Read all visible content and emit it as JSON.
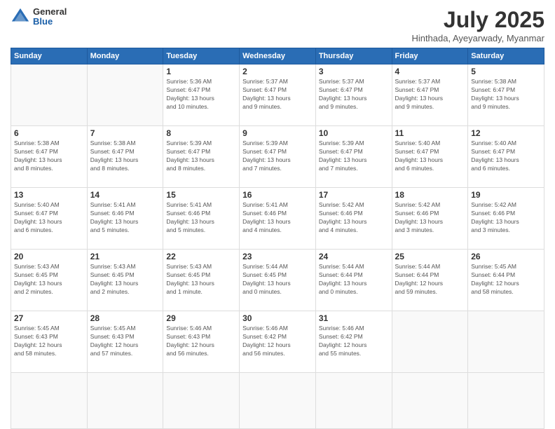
{
  "logo": {
    "general": "General",
    "blue": "Blue"
  },
  "title": "July 2025",
  "location": "Hinthada, Ayeyarwady, Myanmar",
  "weekdays": [
    "Sunday",
    "Monday",
    "Tuesday",
    "Wednesday",
    "Thursday",
    "Friday",
    "Saturday"
  ],
  "days": [
    {
      "date": "",
      "content": ""
    },
    {
      "date": "",
      "content": ""
    },
    {
      "date": "1",
      "content": "Sunrise: 5:36 AM\nSunset: 6:47 PM\nDaylight: 13 hours\nand 10 minutes."
    },
    {
      "date": "2",
      "content": "Sunrise: 5:37 AM\nSunset: 6:47 PM\nDaylight: 13 hours\nand 9 minutes."
    },
    {
      "date": "3",
      "content": "Sunrise: 5:37 AM\nSunset: 6:47 PM\nDaylight: 13 hours\nand 9 minutes."
    },
    {
      "date": "4",
      "content": "Sunrise: 5:37 AM\nSunset: 6:47 PM\nDaylight: 13 hours\nand 9 minutes."
    },
    {
      "date": "5",
      "content": "Sunrise: 5:38 AM\nSunset: 6:47 PM\nDaylight: 13 hours\nand 9 minutes."
    },
    {
      "date": "6",
      "content": "Sunrise: 5:38 AM\nSunset: 6:47 PM\nDaylight: 13 hours\nand 8 minutes."
    },
    {
      "date": "7",
      "content": "Sunrise: 5:38 AM\nSunset: 6:47 PM\nDaylight: 13 hours\nand 8 minutes."
    },
    {
      "date": "8",
      "content": "Sunrise: 5:39 AM\nSunset: 6:47 PM\nDaylight: 13 hours\nand 8 minutes."
    },
    {
      "date": "9",
      "content": "Sunrise: 5:39 AM\nSunset: 6:47 PM\nDaylight: 13 hours\nand 7 minutes."
    },
    {
      "date": "10",
      "content": "Sunrise: 5:39 AM\nSunset: 6:47 PM\nDaylight: 13 hours\nand 7 minutes."
    },
    {
      "date": "11",
      "content": "Sunrise: 5:40 AM\nSunset: 6:47 PM\nDaylight: 13 hours\nand 6 minutes."
    },
    {
      "date": "12",
      "content": "Sunrise: 5:40 AM\nSunset: 6:47 PM\nDaylight: 13 hours\nand 6 minutes."
    },
    {
      "date": "13",
      "content": "Sunrise: 5:40 AM\nSunset: 6:47 PM\nDaylight: 13 hours\nand 6 minutes."
    },
    {
      "date": "14",
      "content": "Sunrise: 5:41 AM\nSunset: 6:46 PM\nDaylight: 13 hours\nand 5 minutes."
    },
    {
      "date": "15",
      "content": "Sunrise: 5:41 AM\nSunset: 6:46 PM\nDaylight: 13 hours\nand 5 minutes."
    },
    {
      "date": "16",
      "content": "Sunrise: 5:41 AM\nSunset: 6:46 PM\nDaylight: 13 hours\nand 4 minutes."
    },
    {
      "date": "17",
      "content": "Sunrise: 5:42 AM\nSunset: 6:46 PM\nDaylight: 13 hours\nand 4 minutes."
    },
    {
      "date": "18",
      "content": "Sunrise: 5:42 AM\nSunset: 6:46 PM\nDaylight: 13 hours\nand 3 minutes."
    },
    {
      "date": "19",
      "content": "Sunrise: 5:42 AM\nSunset: 6:46 PM\nDaylight: 13 hours\nand 3 minutes."
    },
    {
      "date": "20",
      "content": "Sunrise: 5:43 AM\nSunset: 6:45 PM\nDaylight: 13 hours\nand 2 minutes."
    },
    {
      "date": "21",
      "content": "Sunrise: 5:43 AM\nSunset: 6:45 PM\nDaylight: 13 hours\nand 2 minutes."
    },
    {
      "date": "22",
      "content": "Sunrise: 5:43 AM\nSunset: 6:45 PM\nDaylight: 13 hours\nand 1 minute."
    },
    {
      "date": "23",
      "content": "Sunrise: 5:44 AM\nSunset: 6:45 PM\nDaylight: 13 hours\nand 0 minutes."
    },
    {
      "date": "24",
      "content": "Sunrise: 5:44 AM\nSunset: 6:44 PM\nDaylight: 13 hours\nand 0 minutes."
    },
    {
      "date": "25",
      "content": "Sunrise: 5:44 AM\nSunset: 6:44 PM\nDaylight: 12 hours\nand 59 minutes."
    },
    {
      "date": "26",
      "content": "Sunrise: 5:45 AM\nSunset: 6:44 PM\nDaylight: 12 hours\nand 58 minutes."
    },
    {
      "date": "27",
      "content": "Sunrise: 5:45 AM\nSunset: 6:43 PM\nDaylight: 12 hours\nand 58 minutes."
    },
    {
      "date": "28",
      "content": "Sunrise: 5:45 AM\nSunset: 6:43 PM\nDaylight: 12 hours\nand 57 minutes."
    },
    {
      "date": "29",
      "content": "Sunrise: 5:46 AM\nSunset: 6:43 PM\nDaylight: 12 hours\nand 56 minutes."
    },
    {
      "date": "30",
      "content": "Sunrise: 5:46 AM\nSunset: 6:42 PM\nDaylight: 12 hours\nand 56 minutes."
    },
    {
      "date": "31",
      "content": "Sunrise: 5:46 AM\nSunset: 6:42 PM\nDaylight: 12 hours\nand 55 minutes."
    },
    {
      "date": "",
      "content": ""
    },
    {
      "date": "",
      "content": ""
    },
    {
      "date": "",
      "content": ""
    }
  ]
}
